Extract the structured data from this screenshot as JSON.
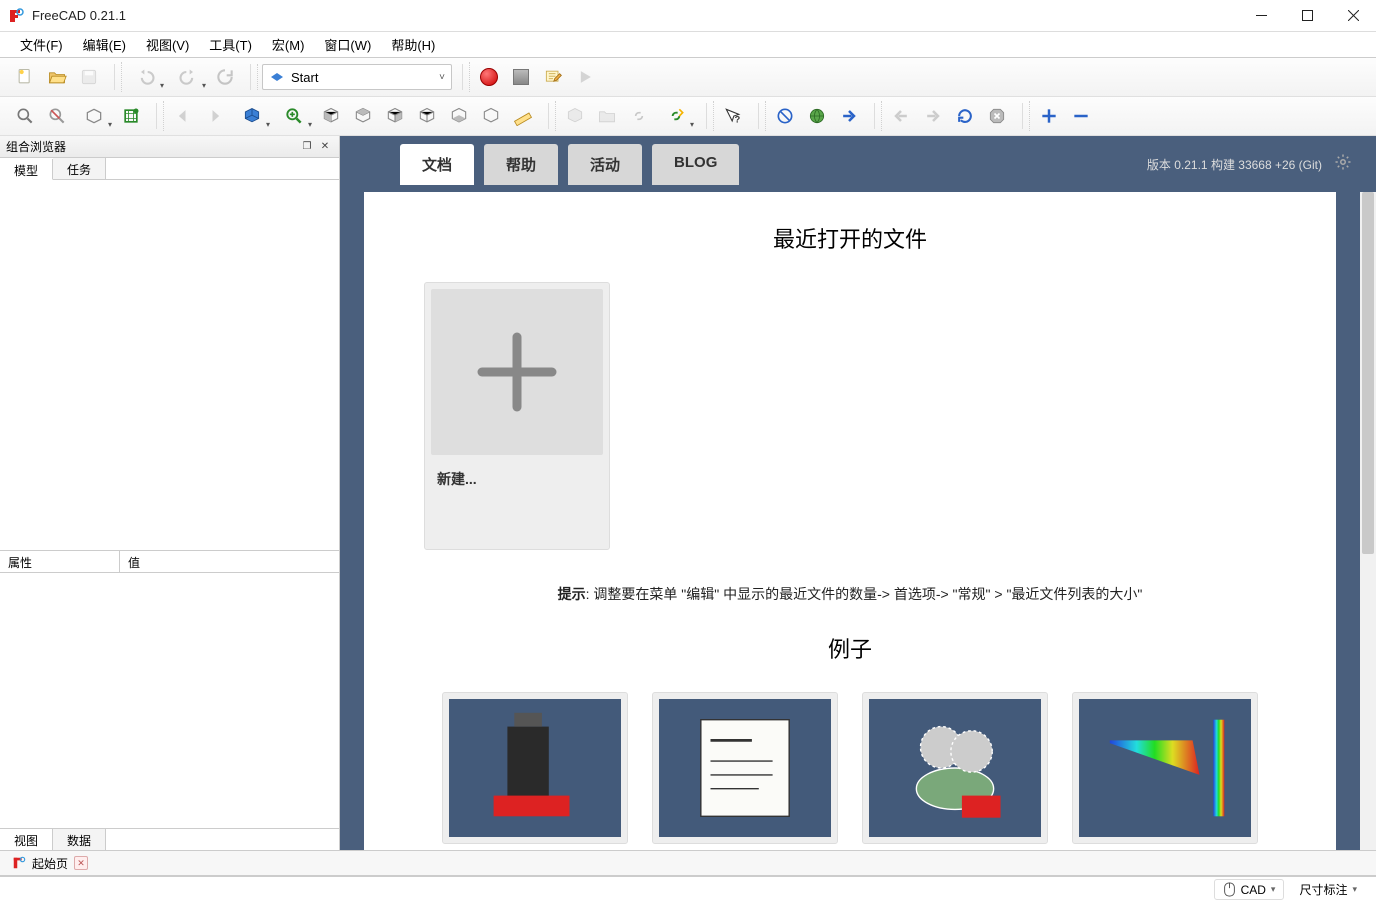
{
  "window": {
    "title": "FreeCAD 0.21.1"
  },
  "menu": {
    "file": "文件(F)",
    "edit": "编辑(E)",
    "view": "视图(V)",
    "tools": "工具(T)",
    "macro": "宏(M)",
    "windows": "窗口(W)",
    "help": "帮助(H)"
  },
  "workbench": {
    "selected": "Start"
  },
  "combo": {
    "title": "组合浏览器",
    "tabs": {
      "model": "模型",
      "task": "任务"
    }
  },
  "props": {
    "col_attr": "属性",
    "col_val": "值",
    "tabs": {
      "view": "视图",
      "data": "数据"
    }
  },
  "start": {
    "tabs": {
      "docs": "文档",
      "help": "帮助",
      "activity": "活动",
      "blog": "BLOG"
    },
    "version": "版本 0.21.1 构建 33668 +26 (Git)",
    "recent_heading": "最近打开的文件",
    "new_label": "新建...",
    "hint_label": "提示",
    "hint_text": ": 调整要在菜单 \"编辑\" 中显示的最近文件的数量-> 首选项-> \"常规\" > \"最近文件列表的大小\"",
    "examples_heading": "例子"
  },
  "doc_tab": {
    "label": "起始页"
  },
  "status": {
    "nav": "CAD",
    "dim": "尺寸标注"
  }
}
